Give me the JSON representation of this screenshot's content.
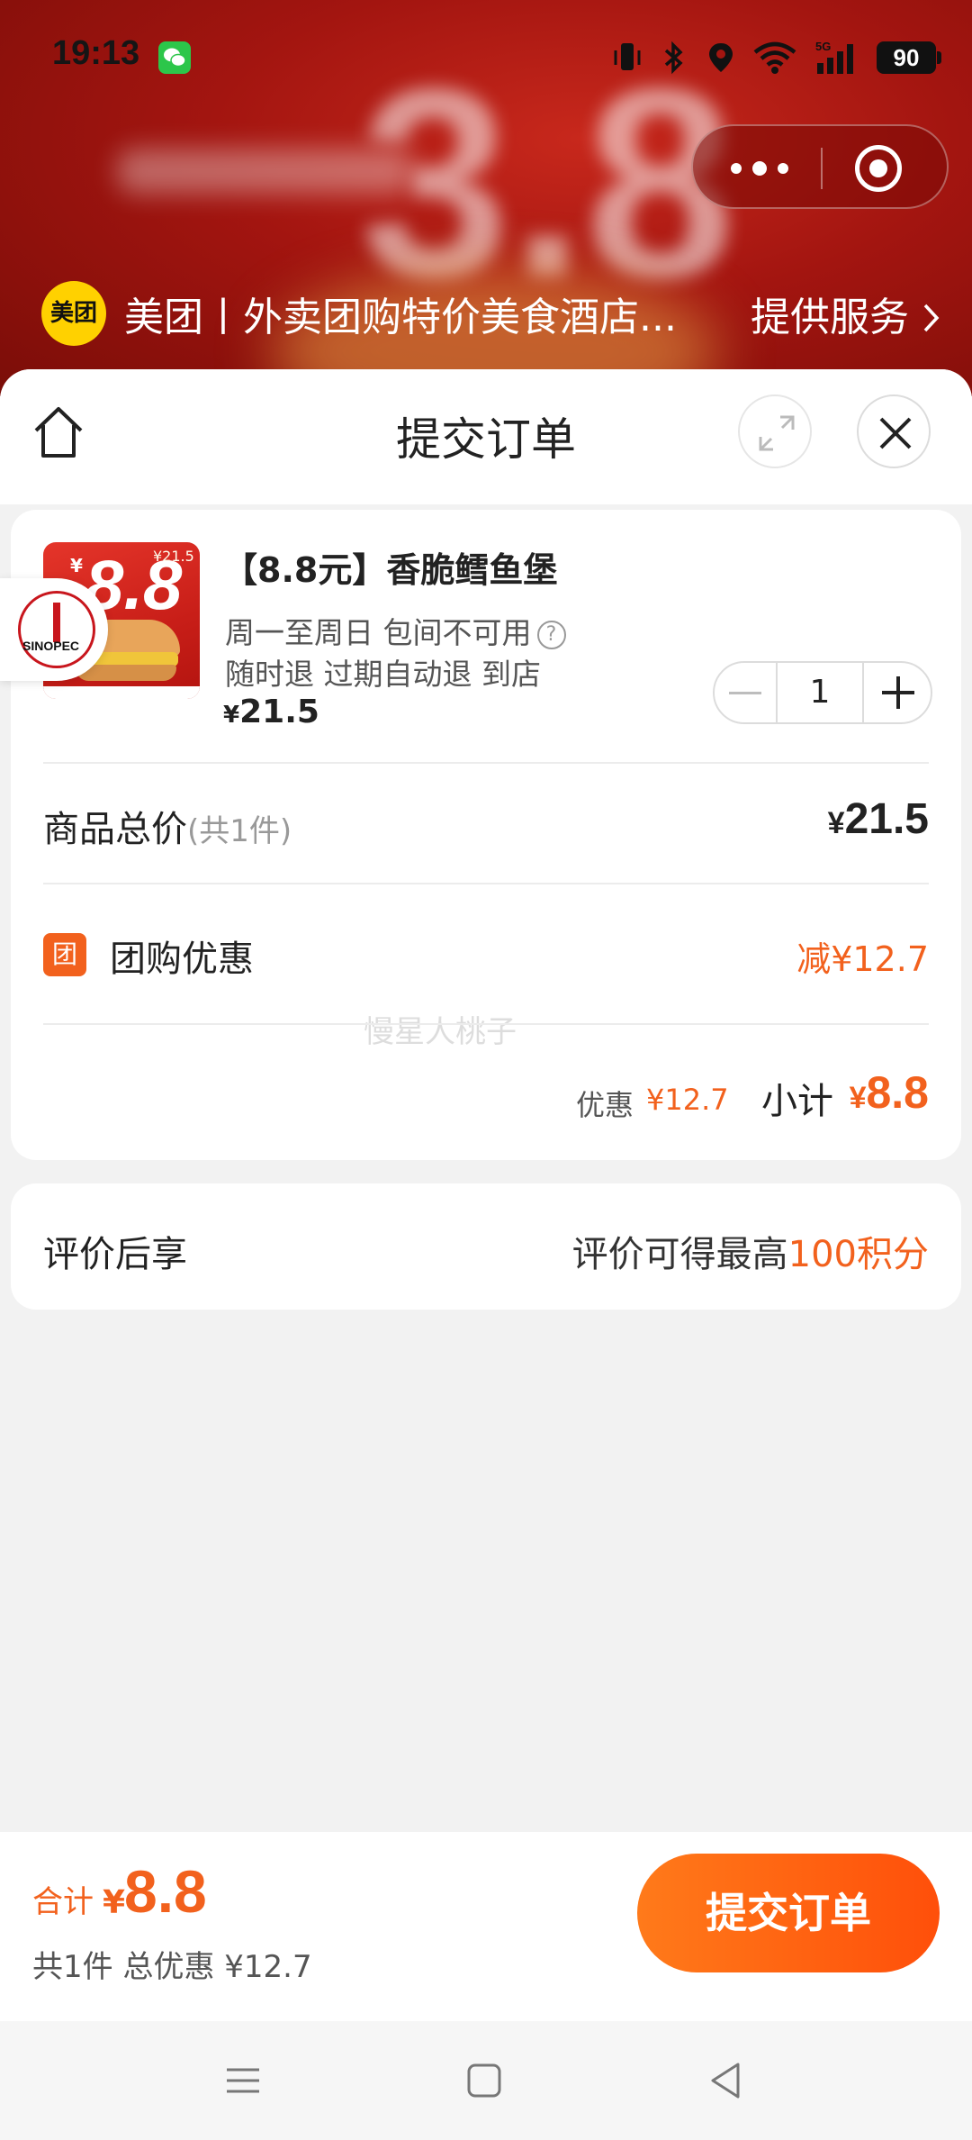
{
  "status_bar": {
    "time": "19:13",
    "battery": "90",
    "network": "5G",
    "icons": [
      "wechat-icon",
      "vibrate-icon",
      "bluetooth-icon",
      "location-icon",
      "wifi-icon",
      "signal-icon",
      "battery-icon"
    ]
  },
  "banner": {
    "blurred_number": "3.8"
  },
  "mini_program": {
    "logo_text": "美团",
    "name": "美团丨外卖团购特价美食酒店...",
    "service_label": "提供服务"
  },
  "header": {
    "title": "提交订单"
  },
  "product": {
    "name": "【8.8元】香脆鳕鱼堡",
    "tag_line1": "周一至周日 包间不可用",
    "tag_line2": "随时退 过期自动退 到店",
    "price_symbol": "¥",
    "price": "21.5",
    "quantity": "1",
    "thumb_price": "8.8",
    "thumb_small": "¥21.5"
  },
  "summary": {
    "total_label": "商品总价",
    "total_count": "(共1件)",
    "total_symbol": "¥",
    "total_value": "21.5",
    "group_icon_text": "团",
    "group_label": "团购优惠",
    "group_value": "减¥12.7",
    "watermark": "慢星人桃子",
    "discount_label": "优惠",
    "discount_value": "¥12.7",
    "subtotal_label": "小计",
    "subtotal_symbol": "¥",
    "subtotal_value": "8.8"
  },
  "review": {
    "label": "评价后享",
    "text_prefix": "评价可得最高",
    "text_highlight": "100积分"
  },
  "float_badge": {
    "text": "SINOPEC"
  },
  "bottom_bar": {
    "sum_label": "合计",
    "sum_symbol": "¥",
    "sum_value": "8.8",
    "detail": "共1件 总优惠 ¥12.7",
    "submit_label": "提交订单"
  },
  "colors": {
    "accent": "#f2611d",
    "banner": "#a31510",
    "meituan_yellow": "#ffd100"
  }
}
